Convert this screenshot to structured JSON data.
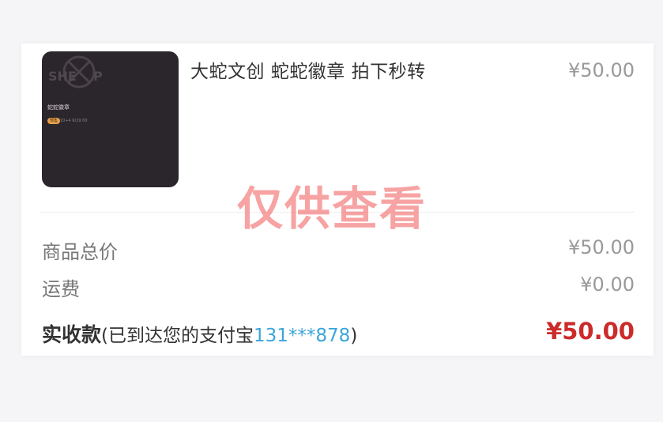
{
  "product": {
    "image_title": "蛇蛇徽章",
    "image_tag": "预售",
    "image_code": "10+4 6/19 00",
    "title": "大蛇文创  蛇蛇徽章  拍下秒转",
    "price": "¥50.00"
  },
  "summary": {
    "subtotal_label": "商品总价",
    "subtotal_value": "¥50.00",
    "shipping_label": "运费",
    "shipping_value": "¥0.00",
    "received_label": "实收款",
    "received_note_prefix": "(已到达您的支付宝",
    "received_account": "131***878",
    "received_note_suffix": ")",
    "received_value": "¥50.00"
  },
  "watermark": {
    "text": "仅供查看"
  },
  "colors": {
    "accent_link": "#3aa5da",
    "amount_red": "#cc2b2b",
    "watermark": "#f26a6a"
  }
}
